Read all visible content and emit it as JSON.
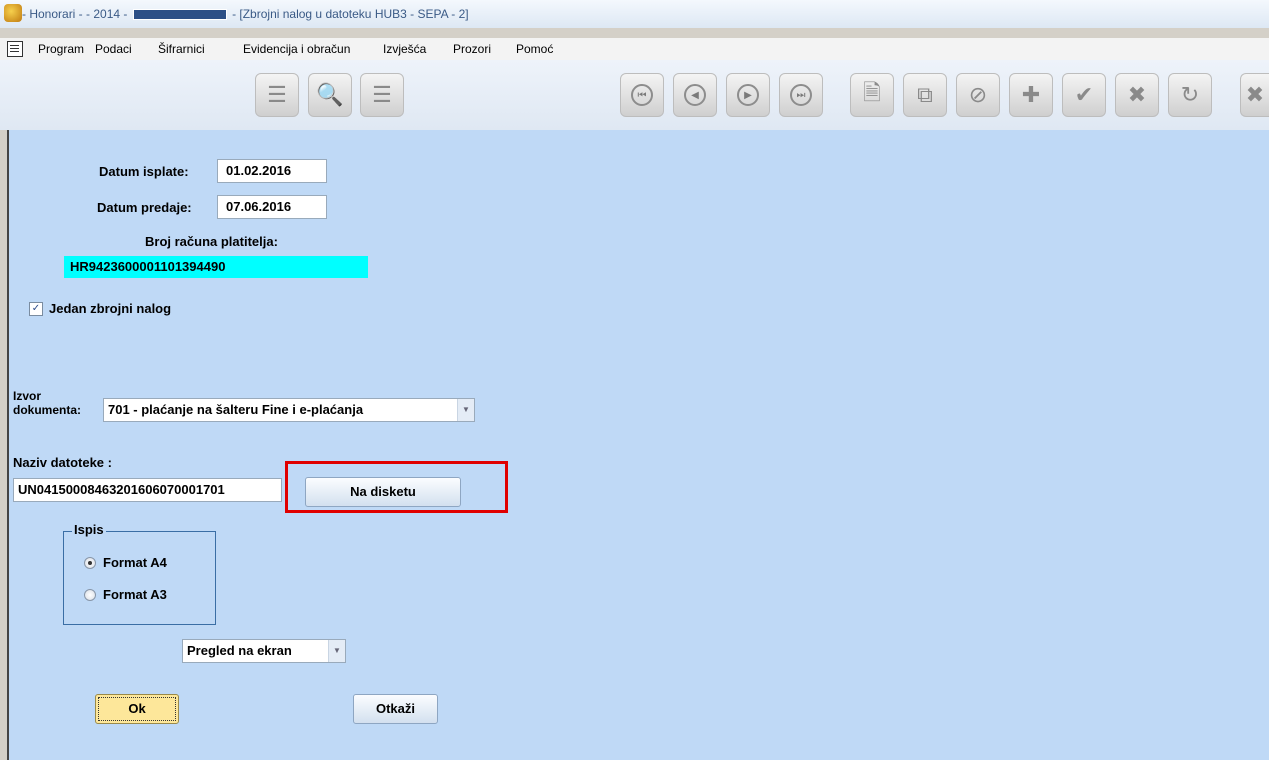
{
  "titlebar": {
    "text_prefix": "- Honorari - - 2014 -",
    "text_suffix": "- [Zbrojni nalog u datoteku HUB3 - SEPA - 2]"
  },
  "menu": [
    "Program",
    "Podaci",
    "Šifrarnici",
    "Evidencija i obračun",
    "Izvješća",
    "Prozori",
    "Pomoć"
  ],
  "toolbar": {
    "icons": [
      "filter-icon",
      "search-icon",
      "database-icon",
      "first-record-icon",
      "previous-record-icon",
      "next-record-icon",
      "last-record-icon",
      "new-document-icon",
      "copy-document-icon",
      "cancel-icon",
      "add-icon",
      "confirm-icon",
      "delete-icon",
      "refresh-icon",
      "clear-filter-icon"
    ]
  },
  "form": {
    "datum_isplate_label": "Datum isplate:",
    "datum_isplate": "01.02.2016",
    "datum_predaje_label": "Datum predaje:",
    "datum_predaje": "07.06.2016",
    "broj_racuna_label": "Broj računa platitelja:",
    "broj_racuna": "HR9423600001101394490",
    "jedan_zbrojni_label": "Jedan zbrojni nalog",
    "jedan_zbrojni_checked": true,
    "izvor_label_1": "Izvor",
    "izvor_label_2": "dokumenta:",
    "izvor_value": "701 - plaćanje na šalteru Fine i e-plaćanja",
    "naziv_label": "Naziv datoteke :",
    "naziv_value": "UN041500084632016060700017​01",
    "na_disketu": "Na disketu",
    "ispis_label": "Ispis",
    "format_a4": "Format A4",
    "format_a3": "Format A3",
    "format_selected": "A4",
    "pregled_value": "Pregled na ekran",
    "ok": "Ok",
    "otkazi": "Otkaži"
  },
  "colors": {
    "content_bg": "#bfd9f6",
    "account_highlight": "#00ffff",
    "annotation_red": "#e00000",
    "ok_button": "#fde79a"
  }
}
